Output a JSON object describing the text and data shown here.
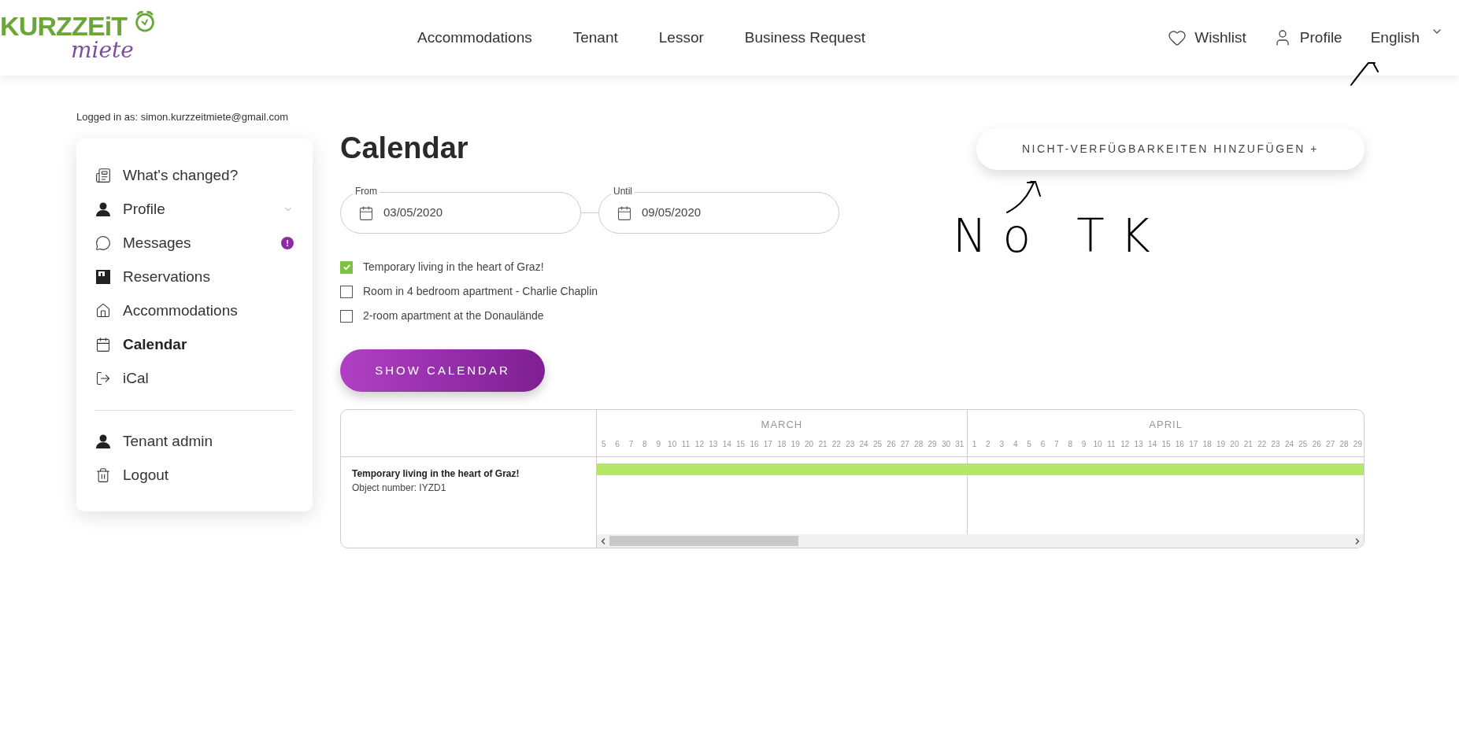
{
  "header": {
    "logo": {
      "word1": "KURZZEiT",
      "word2": "miete"
    },
    "nav": [
      "Accommodations",
      "Tenant",
      "Lessor",
      "Business Request"
    ],
    "actions": [
      {
        "kind": "wishlist",
        "label": "Wishlist"
      },
      {
        "kind": "profile",
        "label": "Profile"
      }
    ],
    "language": "English"
  },
  "logged_in": "Logged in as: simon.kurzzeitmiete@gmail.com",
  "sidebar": {
    "groups": [
      [
        {
          "kind": "news",
          "label": "What's changed?",
          "selected": false,
          "submenu": false
        },
        {
          "kind": "user",
          "label": "Profile",
          "selected": false,
          "submenu": true
        },
        {
          "kind": "chat",
          "label": "Messages",
          "selected": false,
          "submenu": false,
          "badge": "!"
        },
        {
          "kind": "reservations",
          "label": "Reservations",
          "selected": false,
          "submenu": false
        },
        {
          "kind": "home",
          "label": "Accommodations",
          "selected": false,
          "submenu": false
        },
        {
          "kind": "calendar",
          "label": "Calendar",
          "selected": true,
          "submenu": false
        },
        {
          "kind": "export",
          "label": "iCal",
          "selected": false,
          "submenu": false
        }
      ],
      [
        {
          "kind": "user",
          "label": "Tenant admin",
          "selected": false,
          "submenu": false
        },
        {
          "kind": "trash",
          "label": "Logout",
          "selected": false,
          "submenu": false
        }
      ]
    ]
  },
  "main": {
    "title": "Calendar",
    "date_range": {
      "from": {
        "label": "From",
        "value": "03/05/2020"
      },
      "until": {
        "label": "Until",
        "value": "09/05/2020"
      }
    },
    "properties": [
      {
        "label": "Temporary living in the heart of Graz!",
        "checked": true
      },
      {
        "label": "Room in 4 bedroom apartment - Charlie Chaplin",
        "checked": false
      },
      {
        "label": "2-room apartment at the Donaulände",
        "checked": false
      }
    ],
    "show_button": "SHOW CALENDAR",
    "add_button": "NICHT-VERFÜGBARKEITEN HINZUFÜGEN +",
    "annotation": "No TK",
    "timeline": {
      "months": [
        {
          "name": "MARCH",
          "days": [
            "5",
            "6",
            "7",
            "8",
            "9",
            "10",
            "11",
            "12",
            "13",
            "14",
            "15",
            "16",
            "17",
            "18",
            "19",
            "20",
            "21",
            "22",
            "23",
            "24",
            "25",
            "26",
            "27",
            "28",
            "29",
            "30",
            "31"
          ]
        },
        {
          "name": "APRIL",
          "days": [
            "1",
            "2",
            "3",
            "4",
            "5",
            "6",
            "7",
            "8",
            "9",
            "10",
            "11",
            "12",
            "13",
            "14",
            "15",
            "16",
            "17",
            "18",
            "19",
            "20",
            "21",
            "22",
            "23",
            "24",
            "25",
            "26",
            "27",
            "28",
            "29"
          ]
        }
      ],
      "rows": [
        {
          "title": "Temporary living in the heart of Graz!",
          "subtitle": "Object number: IYZD1"
        }
      ]
    }
  }
}
